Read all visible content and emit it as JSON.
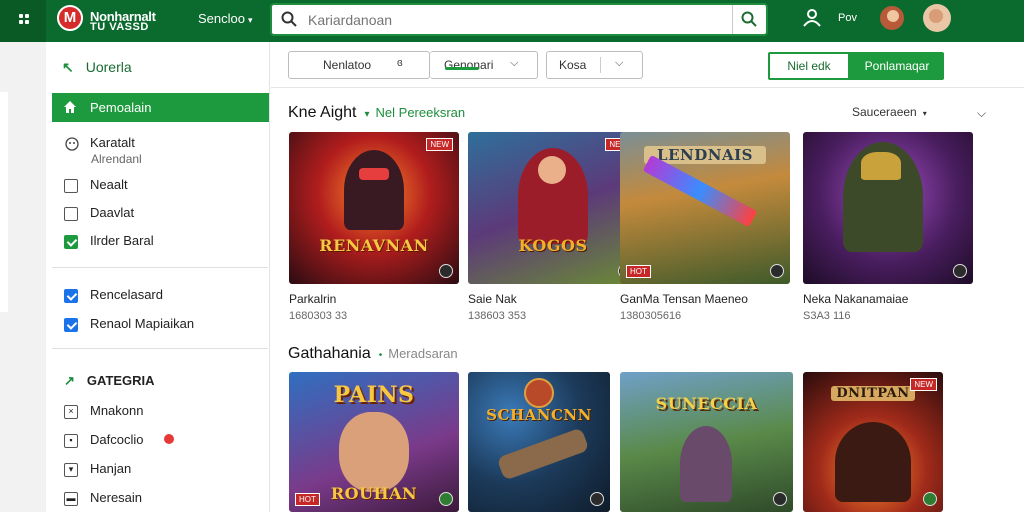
{
  "header": {
    "brand_line1": "Nonharnalt",
    "brand_line2": "TU VASSD",
    "logo_letter": "M",
    "nav_select": "Sencloo",
    "search_placeholder": "Kariardanoan",
    "user_label": "Pov"
  },
  "sidebar": {
    "heading": "Uorerla",
    "active_item": "Pemoalain",
    "items": [
      {
        "label": "Karatalt",
        "sub": "Alrendanl",
        "icon": "gamepad-icon"
      },
      {
        "label": "Neaalt",
        "checked": false
      },
      {
        "label": "Daavlat",
        "checked": false
      },
      {
        "label": "Ilrder Baral",
        "checked": true
      }
    ],
    "checks": [
      {
        "label": "Rencelasard",
        "checked": true
      },
      {
        "label": "Renaol Mapiaikan",
        "checked": true
      }
    ],
    "category_heading": "GATEGRIA",
    "categories": [
      {
        "label": "Mnakonn"
      },
      {
        "label": "Dafcoclio"
      },
      {
        "label": "Hanjan"
      },
      {
        "label": "Neresain"
      }
    ]
  },
  "filters": {
    "select1": "Nenlatoo",
    "select2": "Genonari",
    "select3": "Kosa",
    "btn_outline": "Niel edk",
    "btn_fill": "Ponlamaqar"
  },
  "section1": {
    "title": "Kne Aight",
    "subtitle": "Nel Pereeksran",
    "sort_label": "Sauceraeen",
    "games": [
      {
        "name": "Parkalrin",
        "meta": "1680303 33",
        "art": "RENAVNAN"
      },
      {
        "name": "Saie Nak",
        "meta": "138603 353",
        "art": "KOGOS"
      },
      {
        "name": "GanMa Tensan Maeneo",
        "meta": "1380305616",
        "art": "LENDNAIS"
      },
      {
        "name": "Neka Nakanamaiae",
        "meta": "S3A3 116",
        "art": ""
      }
    ]
  },
  "section2": {
    "title": "Gathahania",
    "subtitle": "Meradsaran",
    "games": [
      {
        "art": "PAINS",
        "art2": "ROUHAN"
      },
      {
        "art": "SCHANCNN"
      },
      {
        "art": "SUNECCIA"
      },
      {
        "art": "DNITPAN"
      }
    ]
  },
  "colors": {
    "brand_green": "#0b6b2e",
    "accent_green": "#1e9a3e",
    "checkbox_blue": "#1a73e8"
  }
}
